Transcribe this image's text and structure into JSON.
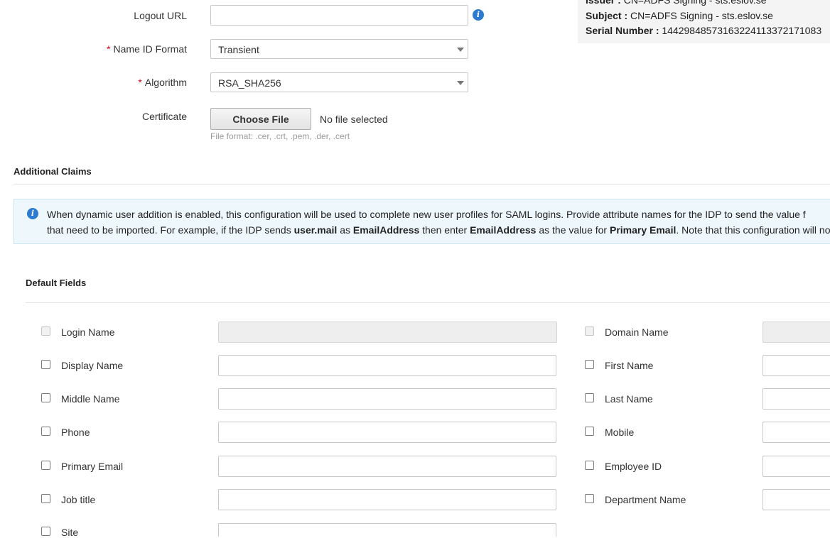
{
  "form": {
    "logout_url": {
      "label": "Logout URL",
      "value": ""
    },
    "name_id_format": {
      "required_mark": "*",
      "label": "Name ID Format",
      "selected": "Transient"
    },
    "algorithm": {
      "required_mark": "*",
      "label": "Algorithm",
      "selected": "RSA_SHA256"
    },
    "certificate": {
      "label": "Certificate",
      "button_label": "Choose File",
      "file_status": "No file selected",
      "hint": "File format: .cer, .crt, .pem, .der, .cert"
    }
  },
  "cert_info": {
    "issuer_label": "Issuer :",
    "issuer_value": "CN=ADFS Signing - sts.eslov.se",
    "subject_label": "Subject :",
    "subject_value": "CN=ADFS Signing - sts.eslov.se",
    "serial_label": "Serial Number :",
    "serial_value": "14429848573163224113372171083"
  },
  "additional_claims": {
    "heading": "Additional Claims",
    "info_line1": "When dynamic user addition is enabled, this configuration will be used to complete new user profiles for SAML logins. Provide attribute names for the IDP to send the value f",
    "info_line2": {
      "t1": "that need to be imported. For example, if the IDP sends ",
      "b1": "user.mail",
      "t2": " as ",
      "b2": "EmailAddress",
      "t3": " then enter ",
      "b3": "EmailAddress",
      "t4": " as the value for ",
      "b4": "Primary Email",
      "t5": ". Note that this configuration will no"
    }
  },
  "default_fields": {
    "heading": "Default Fields",
    "left": [
      {
        "label": "Login Name",
        "checked": false,
        "disabled": true,
        "value": ""
      },
      {
        "label": "Display Name",
        "checked": false,
        "disabled": false,
        "value": ""
      },
      {
        "label": "Middle Name",
        "checked": false,
        "disabled": false,
        "value": ""
      },
      {
        "label": "Phone",
        "checked": false,
        "disabled": false,
        "value": ""
      },
      {
        "label": "Primary Email",
        "checked": false,
        "disabled": false,
        "value": ""
      },
      {
        "label": "Job title",
        "checked": false,
        "disabled": false,
        "value": ""
      },
      {
        "label": "Site",
        "checked": false,
        "disabled": false,
        "value": ""
      }
    ],
    "right": [
      {
        "label": "Domain Name",
        "checked": false,
        "disabled": true,
        "value": ""
      },
      {
        "label": "First Name",
        "checked": false,
        "disabled": false,
        "value": ""
      },
      {
        "label": "Last Name",
        "checked": false,
        "disabled": false,
        "value": ""
      },
      {
        "label": "Mobile",
        "checked": false,
        "disabled": false,
        "value": ""
      },
      {
        "label": "Employee ID",
        "checked": false,
        "disabled": false,
        "value": ""
      },
      {
        "label": "Department Name",
        "checked": false,
        "disabled": false,
        "value": ""
      }
    ]
  },
  "colors": {
    "accent": "#2c7bd1",
    "required": "#d0021b",
    "info_bg": "#eef8fc"
  },
  "icons": {
    "info": "info-circle-icon",
    "dropdown": "chevron-down-icon"
  }
}
